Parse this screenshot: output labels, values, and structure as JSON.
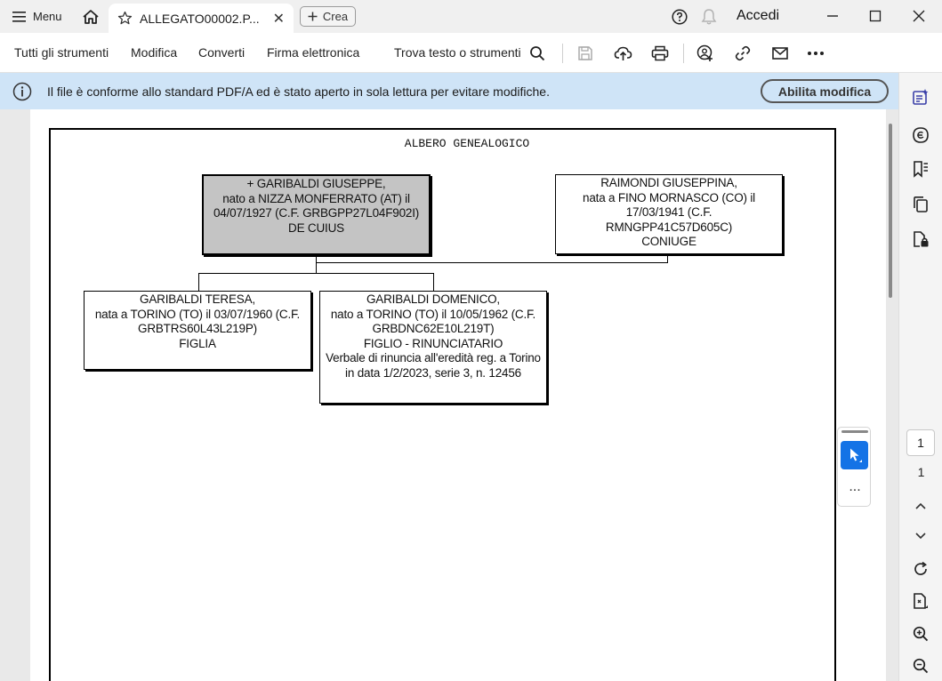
{
  "titlebar": {
    "menu_label": "Menu",
    "tab_title": "ALLEGATO00002.P...",
    "create_label": "Crea",
    "signin_label": "Accedi"
  },
  "toolbar": {
    "all_tools": "Tutti gli strumenti",
    "edit": "Modifica",
    "convert": "Converti",
    "esign": "Firma elettronica",
    "find": "Trova testo o strumenti"
  },
  "infobar": {
    "message": "Il file è conforme allo standard PDF/A ed è stato aperto in sola lettura per evitare modifiche.",
    "enable_edit": "Abilita modifica"
  },
  "document": {
    "title": "ALBERO GENEALOGICO",
    "deceased": [
      "+ GARIBALDI GIUSEPPE,",
      "nato a NIZZA MONFERRATO (AT) il",
      "04/07/1927 (C.F. GRBGPP27L04F902I)",
      "DE CUIUS"
    ],
    "spouse": [
      "RAIMONDI GIUSEPPINA,",
      "nata a FINO MORNASCO (CO) il",
      "17/03/1941 (C.F.",
      "RMNGPP41C57D605C)",
      "CONIUGE"
    ],
    "child1": [
      "GARIBALDI TERESA,",
      "nata a TORINO (TO) il 03/07/1960 (C.F.",
      "GRBTRS60L43L219P)",
      "FIGLIA"
    ],
    "child2": [
      "GARIBALDI DOMENICO,",
      "nato a TORINO (TO) il 10/05/1962 (C.F.",
      "GRBDNC62E10L219T)",
      "FIGLIO - RINUNCIATARIO",
      "Verbale di rinuncia all'eredità reg. a Torino",
      "in data 1/2/2023, serie 3, n. 12456"
    ]
  },
  "float_tool": {
    "more": "..."
  },
  "pagination": {
    "current": "1",
    "total": "1"
  }
}
